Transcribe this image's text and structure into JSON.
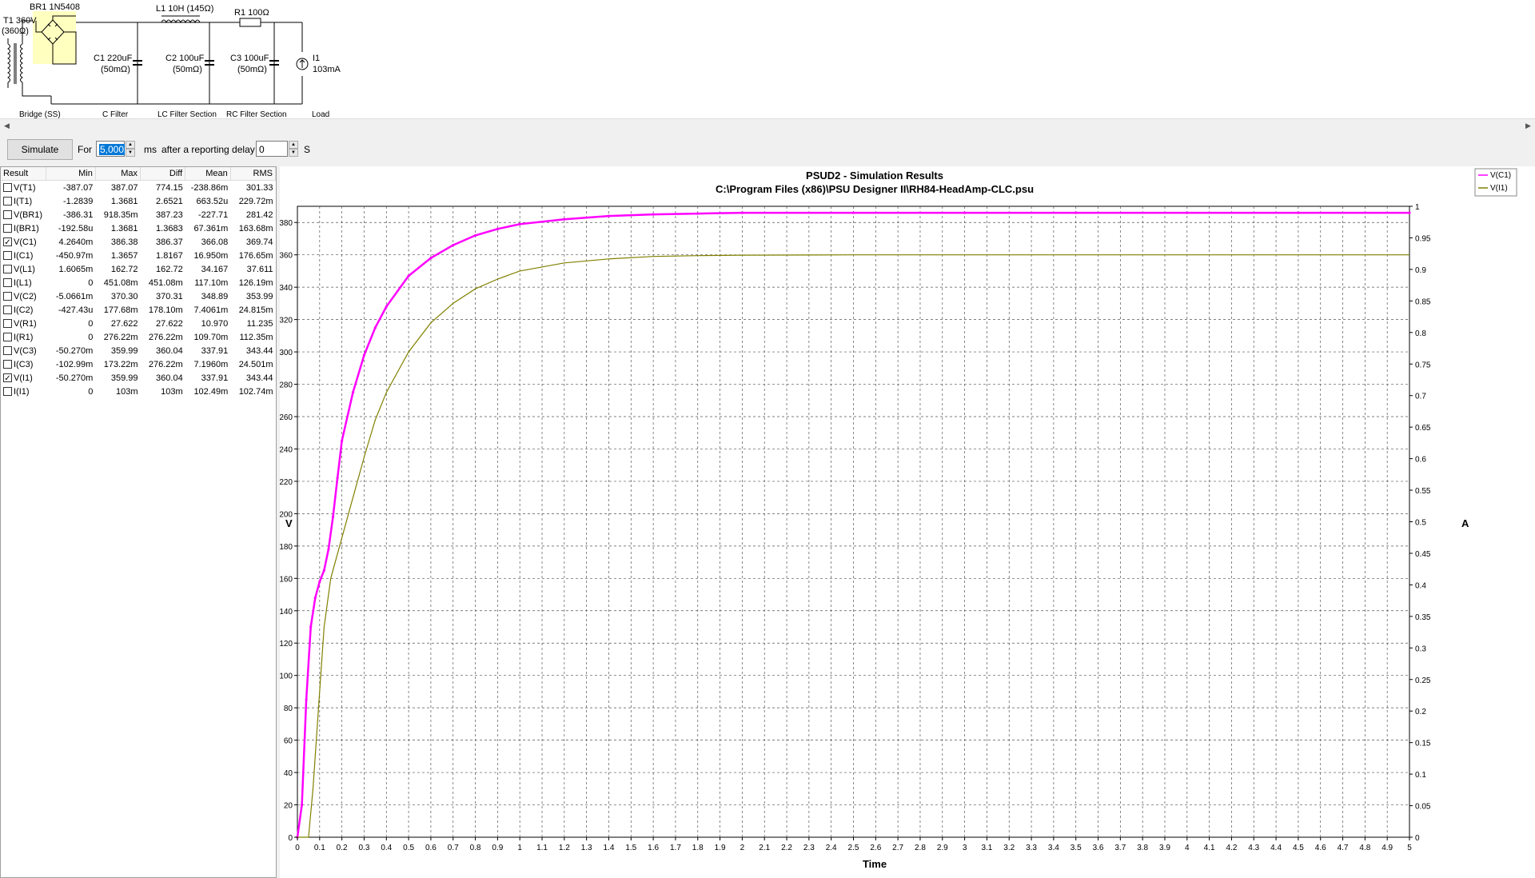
{
  "schematic": {
    "components": {
      "t1_name": "T1 360V",
      "t1_res": "(360Ω)",
      "br1": "BR1 1N5408",
      "l1": "L1 10H (145Ω)",
      "r1": "R1 100Ω",
      "c1_name": "C1 220uF",
      "c1_esr": "(50mΩ)",
      "c2_name": "C2 100uF",
      "c2_esr": "(50mΩ)",
      "c3_name": "C3 100uF",
      "c3_esr": "(50mΩ)",
      "i1_name": "I1",
      "i1_val": "103mA"
    },
    "sections": [
      "Bridge (SS)",
      "C Filter",
      "LC Filter Section",
      "RC Filter Section",
      "Load"
    ]
  },
  "toolbar": {
    "simulate": "Simulate",
    "for_label": "For",
    "duration": "5,000",
    "ms": "ms",
    "delay_label": "after a reporting delay of",
    "delay": "0",
    "s": "S"
  },
  "results": {
    "headers": [
      "Result",
      "Min",
      "Max",
      "Diff",
      "Mean",
      "RMS"
    ],
    "rows": [
      {
        "name": "V(T1)",
        "checked": false,
        "min": "-387.07",
        "max": "387.07",
        "diff": "774.15",
        "mean": "-238.86m",
        "rms": "301.33"
      },
      {
        "name": "I(T1)",
        "checked": false,
        "min": "-1.2839",
        "max": "1.3681",
        "diff": "2.6521",
        "mean": "663.52u",
        "rms": "229.72m"
      },
      {
        "name": "V(BR1)",
        "checked": false,
        "min": "-386.31",
        "max": "918.35m",
        "diff": "387.23",
        "mean": "-227.71",
        "rms": "281.42"
      },
      {
        "name": "I(BR1)",
        "checked": false,
        "min": "-192.58u",
        "max": "1.3681",
        "diff": "1.3683",
        "mean": "67.361m",
        "rms": "163.68m"
      },
      {
        "name": "V(C1)",
        "checked": true,
        "min": "4.2640m",
        "max": "386.38",
        "diff": "386.37",
        "mean": "366.08",
        "rms": "369.74"
      },
      {
        "name": "I(C1)",
        "checked": false,
        "min": "-450.97m",
        "max": "1.3657",
        "diff": "1.8167",
        "mean": "16.950m",
        "rms": "176.65m"
      },
      {
        "name": "V(L1)",
        "checked": false,
        "min": "1.6065m",
        "max": "162.72",
        "diff": "162.72",
        "mean": "34.167",
        "rms": "37.611"
      },
      {
        "name": "I(L1)",
        "checked": false,
        "min": "0",
        "max": "451.08m",
        "diff": "451.08m",
        "mean": "117.10m",
        "rms": "126.19m"
      },
      {
        "name": "V(C2)",
        "checked": false,
        "min": "-5.0661m",
        "max": "370.30",
        "diff": "370.31",
        "mean": "348.89",
        "rms": "353.99"
      },
      {
        "name": "I(C2)",
        "checked": false,
        "min": "-427.43u",
        "max": "177.68m",
        "diff": "178.10m",
        "mean": "7.4061m",
        "rms": "24.815m"
      },
      {
        "name": "V(R1)",
        "checked": false,
        "min": "0",
        "max": "27.622",
        "diff": "27.622",
        "mean": "10.970",
        "rms": "11.235"
      },
      {
        "name": "I(R1)",
        "checked": false,
        "min": "0",
        "max": "276.22m",
        "diff": "276.22m",
        "mean": "109.70m",
        "rms": "112.35m"
      },
      {
        "name": "V(C3)",
        "checked": false,
        "min": "-50.270m",
        "max": "359.99",
        "diff": "360.04",
        "mean": "337.91",
        "rms": "343.44"
      },
      {
        "name": "I(C3)",
        "checked": false,
        "min": "-102.99m",
        "max": "173.22m",
        "diff": "276.22m",
        "mean": "7.1960m",
        "rms": "24.501m"
      },
      {
        "name": "V(I1)",
        "checked": true,
        "min": "-50.270m",
        "max": "359.99",
        "diff": "360.04",
        "mean": "337.91",
        "rms": "343.44"
      },
      {
        "name": "I(I1)",
        "checked": false,
        "min": "0",
        "max": "103m",
        "diff": "103m",
        "mean": "102.49m",
        "rms": "102.74m"
      }
    ]
  },
  "chart_data": {
    "type": "line",
    "title": "PSUD2 - Simulation Results",
    "subtitle": "C:\\Program Files (x86)\\PSU Designer II\\RH84-HeadAmp-CLC.psu",
    "xlabel": "Time",
    "ylabel": "V",
    "y2label": "A",
    "xlim": [
      0,
      5
    ],
    "ylim": [
      0,
      390
    ],
    "y2lim": [
      0,
      1
    ],
    "xticks": [
      0,
      0.1,
      0.2,
      0.3,
      0.4,
      0.5,
      0.6,
      0.7,
      0.8,
      0.9,
      1,
      1.1,
      1.2,
      1.3,
      1.4,
      1.5,
      1.6,
      1.7,
      1.8,
      1.9,
      2,
      2.1,
      2.2,
      2.3,
      2.4,
      2.5,
      2.6,
      2.7,
      2.8,
      2.9,
      3,
      3.1,
      3.2,
      3.3,
      3.4,
      3.5,
      3.6,
      3.7,
      3.8,
      3.9,
      4,
      4.1,
      4.2,
      4.3,
      4.4,
      4.5,
      4.6,
      4.7,
      4.8,
      4.9,
      5
    ],
    "yticks": [
      0,
      20,
      40,
      60,
      80,
      100,
      120,
      140,
      160,
      180,
      200,
      220,
      240,
      260,
      280,
      300,
      320,
      340,
      360,
      380
    ],
    "y2ticks": [
      0,
      0.05,
      0.1,
      0.15,
      0.2,
      0.25,
      0.3,
      0.35,
      0.4,
      0.45,
      0.5,
      0.55,
      0.6,
      0.65,
      0.7,
      0.75,
      0.8,
      0.85,
      0.9,
      0.95,
      1
    ],
    "grid": true,
    "legend_position": "top-right",
    "series": [
      {
        "name": "V(C1)",
        "color": "#ff00ff",
        "x": [
          0,
          0.02,
          0.04,
          0.06,
          0.08,
          0.1,
          0.12,
          0.14,
          0.16,
          0.18,
          0.2,
          0.25,
          0.3,
          0.35,
          0.4,
          0.5,
          0.6,
          0.7,
          0.8,
          0.9,
          1,
          1.2,
          1.4,
          1.6,
          1.8,
          2,
          2.5,
          3,
          3.5,
          4,
          4.5,
          5
        ],
        "y": [
          0,
          20,
          85,
          130,
          148,
          158,
          165,
          178,
          198,
          222,
          245,
          275,
          298,
          315,
          328,
          347,
          358,
          366,
          372,
          376,
          379,
          382,
          384,
          385,
          385.5,
          386,
          386,
          386,
          386,
          386,
          386,
          386
        ]
      },
      {
        "name": "V(I1)",
        "color": "#808000",
        "x": [
          0,
          0.05,
          0.07,
          0.1,
          0.12,
          0.15,
          0.2,
          0.25,
          0.3,
          0.35,
          0.4,
          0.5,
          0.6,
          0.7,
          0.8,
          0.9,
          1,
          1.2,
          1.4,
          1.6,
          1.8,
          2,
          2.5,
          3,
          4,
          5
        ],
        "y": [
          0,
          0,
          30,
          90,
          130,
          160,
          185,
          210,
          235,
          258,
          275,
          300,
          318,
          330,
          339,
          345,
          350,
          355,
          357.5,
          359,
          359.5,
          359.8,
          360,
          360,
          360,
          360
        ]
      }
    ]
  }
}
